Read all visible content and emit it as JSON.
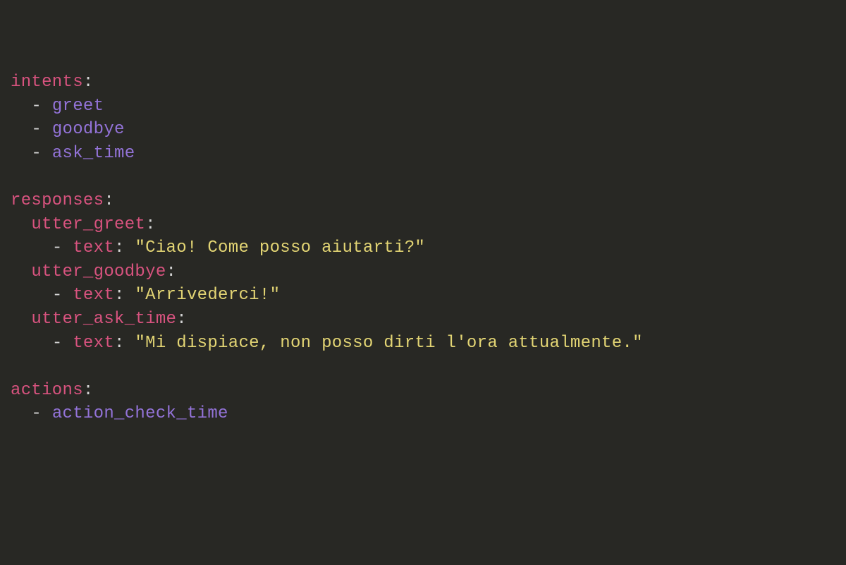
{
  "code": {
    "intents_key": "intents",
    "intents": [
      "greet",
      "goodbye",
      "ask_time"
    ],
    "responses_key": "responses",
    "responses": [
      {
        "name": "utter_greet",
        "text_key": "text",
        "text_value": "\"Ciao! Come posso aiutarti?\""
      },
      {
        "name": "utter_goodbye",
        "text_key": "text",
        "text_value": "\"Arrivederci!\""
      },
      {
        "name": "utter_ask_time",
        "text_key": "text",
        "text_value": "\"Mi dispiace, non posso dirti l'ora attualmente.\""
      }
    ],
    "actions_key": "actions",
    "actions": [
      "action_check_time"
    ]
  }
}
